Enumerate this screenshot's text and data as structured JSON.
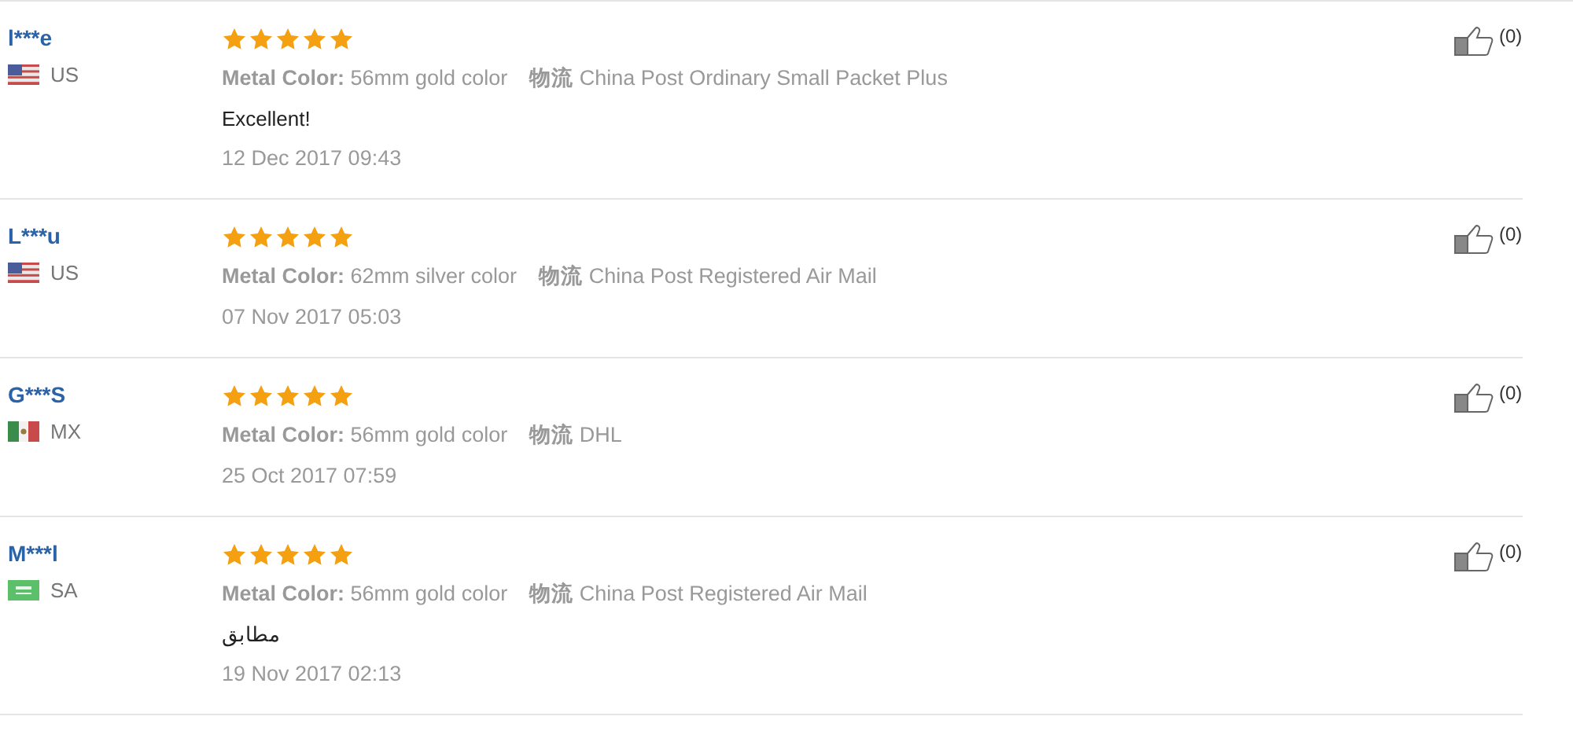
{
  "reviews": [
    {
      "name": "l***e",
      "kind": "us",
      "country": "US",
      "stars": 5,
      "attr_label": "Metal Color:",
      "attr_value": "56mm gold color",
      "ship_label": "物流",
      "ship_value": "China Post Ordinary Small Packet Plus",
      "comment": "Excellent!",
      "date": "12 Dec 2017 09:43",
      "likes": "(0)"
    },
    {
      "name": "L***u",
      "kind": "us",
      "country": "US",
      "stars": 5,
      "attr_label": "Metal Color:",
      "attr_value": "62mm silver color",
      "ship_label": "物流",
      "ship_value": "China Post Registered Air Mail",
      "date": "07 Nov 2017 05:03",
      "likes": "(0)"
    },
    {
      "name": "G***S",
      "kind": "mx",
      "country": "MX",
      "stars": 5,
      "attr_label": "Metal Color:",
      "attr_value": "56mm gold color",
      "ship_label": "物流",
      "ship_value": "DHL",
      "date": "25 Oct 2017 07:59",
      "likes": "(0)"
    },
    {
      "name": "M***l",
      "kind": "sa",
      "country": "SA",
      "stars": 5,
      "attr_label": "Metal Color:",
      "attr_value": "56mm gold color",
      "ship_label": "物流",
      "ship_value": "China Post Registered Air Mail",
      "comment": "مطابق",
      "date": "19 Nov 2017 02:13",
      "likes": "(0)"
    }
  ]
}
